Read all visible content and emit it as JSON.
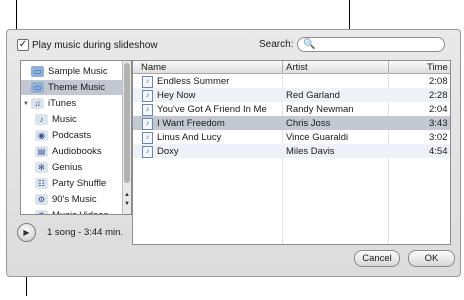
{
  "dialog": {
    "checkbox_label": "Play music during slideshow",
    "checkbox_checked": true,
    "checkbox_mark": "✓",
    "search_label": "Search:",
    "search_placeholder": "",
    "search_icon": "🔍"
  },
  "sidebar": {
    "items": [
      {
        "label": "Sample Music",
        "icon": "folder-icon",
        "glyph": "▭",
        "selected": false
      },
      {
        "label": "Theme Music",
        "icon": "folder-icon",
        "glyph": "▭",
        "selected": true
      },
      {
        "label": "iTunes",
        "icon": "itunes-icon",
        "glyph": "♫",
        "selected": false,
        "expanded": true
      },
      {
        "label": "Music",
        "icon": "music-icon",
        "glyph": "♪",
        "selected": false
      },
      {
        "label": "Podcasts",
        "icon": "podcast-icon",
        "glyph": "◉",
        "selected": false
      },
      {
        "label": "Audiobooks",
        "icon": "book-icon",
        "glyph": "▤",
        "selected": false
      },
      {
        "label": "Genius",
        "icon": "genius-icon",
        "glyph": "✻",
        "selected": false
      },
      {
        "label": "Party Shuffle",
        "icon": "shuffle-icon",
        "glyph": "☷",
        "selected": false
      },
      {
        "label": "90's Music",
        "icon": "gear-icon",
        "glyph": "⚙",
        "selected": false
      },
      {
        "label": "Music Videos",
        "icon": "gear-icon",
        "glyph": "⚙",
        "selected": false
      }
    ]
  },
  "table": {
    "columns": [
      "Name",
      "Artist",
      "Time"
    ],
    "rows": [
      {
        "name": "Endless Summer",
        "artist": "",
        "time": "2:08"
      },
      {
        "name": "Hey Now",
        "artist": "Red Garland",
        "time": "2:28"
      },
      {
        "name": "You've Got A Friend In Me",
        "artist": "Randy Newman",
        "time": "2:04"
      },
      {
        "name": "I Want Freedom",
        "artist": "Chris Joss",
        "time": "3:43",
        "selected": true
      },
      {
        "name": "Linus And Lucy",
        "artist": "Vince Guaraldi",
        "time": "3:02"
      },
      {
        "name": "Doxy",
        "artist": "Miles Davis",
        "time": "4:54"
      }
    ]
  },
  "footer": {
    "play_glyph": "▶",
    "song_info": "1 song - 3:44 min.",
    "cancel_label": "Cancel",
    "ok_label": "OK"
  }
}
